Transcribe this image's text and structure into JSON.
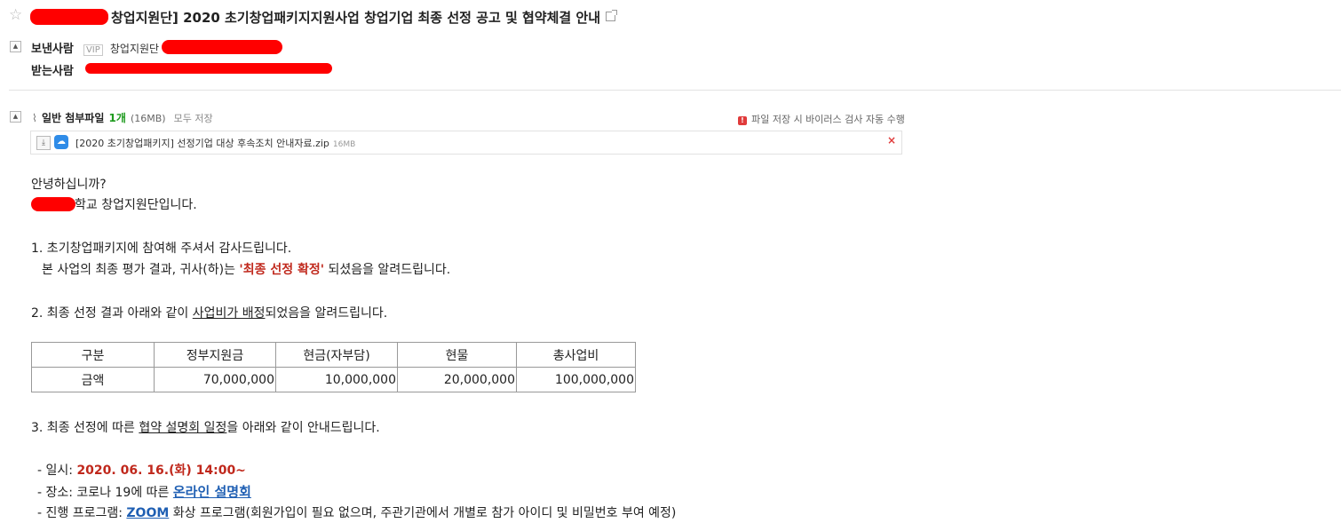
{
  "header": {
    "subject": "창업지원단] 2020 초기창업패키지지원사업 창업기업 최종 선정 공고 및 협약체결 안내",
    "sender_label": "보낸사람",
    "vip_badge": "VIP",
    "sender_name": "창업지원단",
    "receiver_label": "받는사람"
  },
  "attachments": {
    "title": "일반 첨부파일",
    "count": "1개",
    "size": "(16MB)",
    "save_all": "모두 저장",
    "virus_notice": "파일 저장 시 바이러스 검사 자동 수행",
    "file": {
      "name": "[2020 초기창업패키지] 선정기업 대상 후속조치 안내자료.zip",
      "size": "16MB"
    }
  },
  "body": {
    "greeting": "안녕하십니까?",
    "org_suffix": "학교 창업지원단입니다.",
    "p1_line1": "1. 초기창업패키지에 참여해 주셔서 감사드립니다.",
    "p1_line2_pre": "본 사업의 최종 평가 결과, 귀사(하)는 ",
    "p1_line2_em": "'최종 선정 확정'",
    "p1_line2_post": " 되셨음을 알려드립니다.",
    "p2_pre": "2. 최종 선정 결과 아래와 같이 ",
    "p2_underlined": "사업비가 배정",
    "p2_post": "되었음을 알려드립니다.",
    "p3_pre": "3. 최종 선정에 따른 ",
    "p3_underlined": "협약 설명회 일정",
    "p3_post": "을 아래와 같이 안내드립니다.",
    "date_label": "- 일시: ",
    "date_value": "2020. 06. 16.(화)  14:00~",
    "place_label": "- 장소: 코로나 19에 따른 ",
    "place_value": "온라인 설명회",
    "program_label": "- 진행 프로그램: ",
    "program_zoom": "ZOOM",
    "program_rest": " 화상 프로그램(회원가입이 필요 없으며, 주관기관에서 개별로 참가 아이디 및 비밀번호 부여 예정)"
  },
  "budget_table": {
    "headers": [
      "구분",
      "정부지원금",
      "현금(자부담)",
      "현물",
      "총사업비"
    ],
    "row": [
      "금액",
      "70,000,000",
      "10,000,000",
      "20,000,000",
      "100,000,000"
    ]
  }
}
